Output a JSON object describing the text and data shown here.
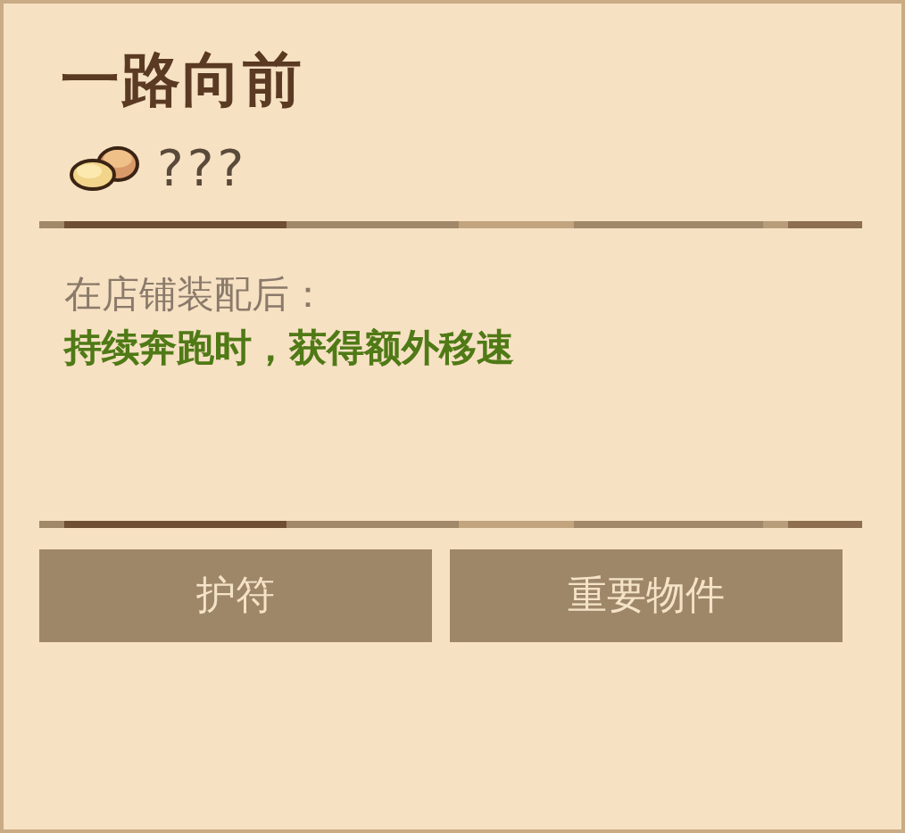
{
  "item": {
    "title": "一路向前",
    "price": "???"
  },
  "effect": {
    "condition": "在店铺装配后：",
    "description": "持续奔跑时，获得额外移速"
  },
  "tags": [
    {
      "label": "护符"
    },
    {
      "label": "重要物件"
    }
  ]
}
